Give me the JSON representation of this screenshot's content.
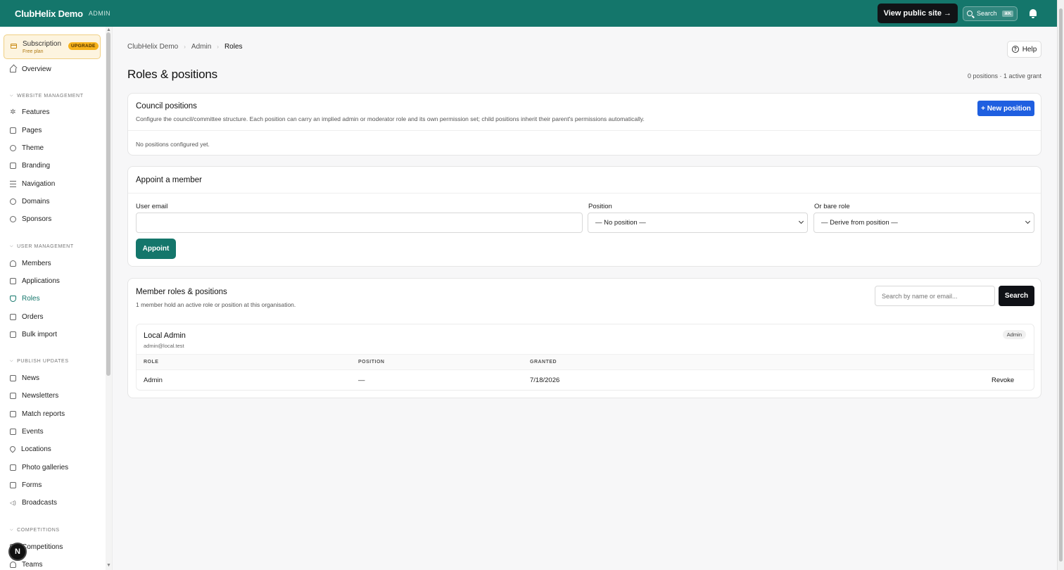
{
  "topbar": {
    "brand": "ClubHelix Demo",
    "tag": "ADMIN",
    "view_site": "View public site →",
    "search_label": "Search",
    "search_kbd": "⌘K"
  },
  "sidebar": {
    "subscription": {
      "title": "Subscription",
      "plan": "Free plan",
      "badge": "UPGRADE"
    },
    "overview": "Overview",
    "sections": {
      "website": "WEBSITE MANAGEMENT",
      "user": "USER MANAGEMENT",
      "publish": "PUBLISH UPDATES",
      "competitions": "COMPETITIONS"
    },
    "website_items": [
      "Features",
      "Pages",
      "Theme",
      "Branding",
      "Navigation",
      "Domains",
      "Sponsors"
    ],
    "user_items": [
      "Members",
      "Applications",
      "Roles",
      "Orders",
      "Bulk import"
    ],
    "publish_items": [
      "News",
      "Newsletters",
      "Match reports",
      "Events",
      "Locations",
      "Photo galleries",
      "Forms",
      "Broadcasts"
    ],
    "competition_items": [
      "Competitions",
      "Teams"
    ],
    "active_item": "Roles",
    "avatar_letter": "N"
  },
  "breadcrumb": [
    "ClubHelix Demo",
    "Admin",
    "Roles"
  ],
  "help": "Help",
  "page": {
    "title": "Roles & positions",
    "counts": "0 positions · 1 active grant"
  },
  "council": {
    "title": "Council positions",
    "description": "Configure the council/committee structure. Each position can carry an implied admin or moderator role and its own permission set; child positions inherit their parent's permissions automatically.",
    "new_button": "+ New position",
    "empty": "No positions configured yet."
  },
  "appoint": {
    "title": "Appoint a member",
    "email_label": "User email",
    "email_value": "",
    "position_label": "Position",
    "position_value": "— No position —",
    "role_label": "Or bare role",
    "role_value": "— Derive from position —",
    "button": "Appoint"
  },
  "members": {
    "title": "Member roles & positions",
    "subtitle": "1 member hold an active role or position at this organisation.",
    "search_placeholder": "Search by name or email...",
    "search_button": "Search",
    "entries": [
      {
        "name": "Local Admin",
        "email": "admin@local.test",
        "badge": "Admin",
        "columns": [
          "ROLE",
          "POSITION",
          "GRANTED"
        ],
        "row": {
          "role": "Admin",
          "position": "—",
          "granted": "7/18/2026",
          "action": "Revoke"
        }
      }
    ]
  }
}
